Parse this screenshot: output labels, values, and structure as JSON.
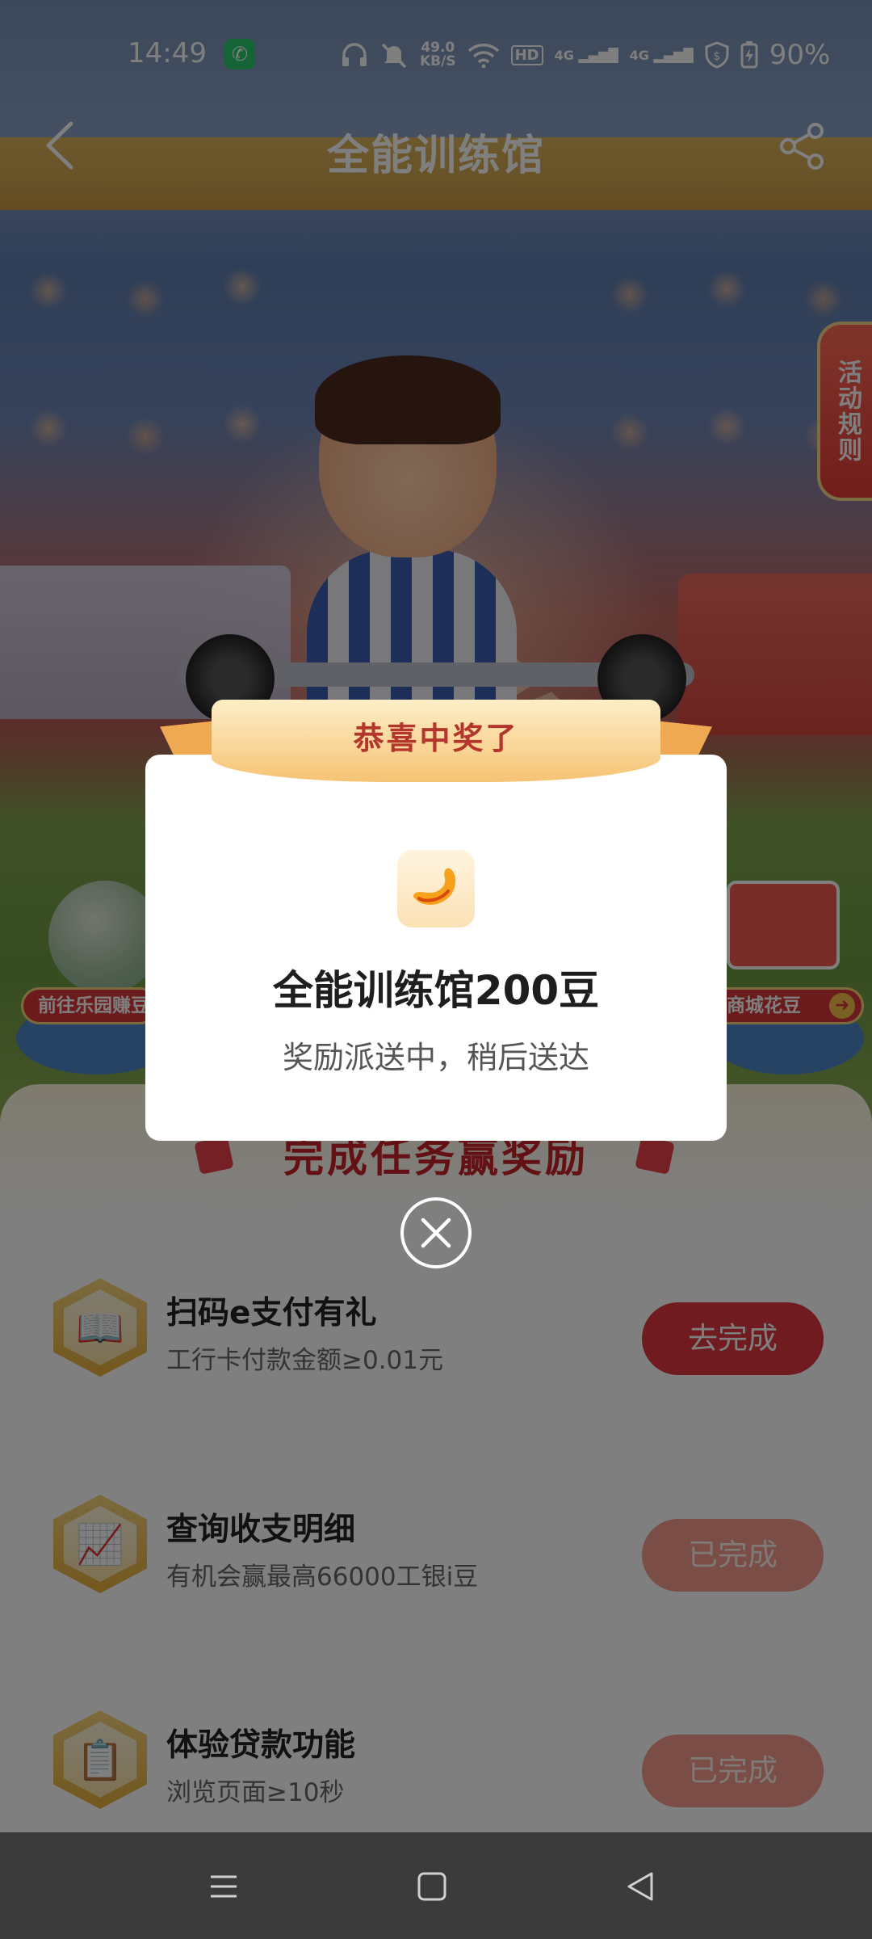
{
  "status_bar": {
    "time": "14:49",
    "net_speed_value": "49.0",
    "net_speed_unit": "KB/S",
    "hd_label": "HD",
    "signal1_label": "4G",
    "signal2_label": "4G",
    "battery": "90%"
  },
  "header": {
    "title": "全能训练馆"
  },
  "rules_tab": "活动规则",
  "entries": {
    "left": "前往乐园赚豆",
    "right": "往商城花豆"
  },
  "task_panel": {
    "title": "完成任务赢奖励",
    "tasks": [
      {
        "title": "扫码e支付有礼",
        "subtitle": "工行卡付款金额≥0.01元",
        "button": "去完成",
        "status": "pending",
        "icon": "book-icon"
      },
      {
        "title": "查询收支明细",
        "subtitle": "有机会赢最高66000工银i豆",
        "button": "已完成",
        "status": "done",
        "icon": "chart-icon"
      },
      {
        "title": "体验贷款功能",
        "subtitle": "浏览页面≥10秒",
        "button": "已完成",
        "status": "done",
        "icon": "clipboard-icon"
      }
    ]
  },
  "modal": {
    "ribbon": "恭喜中奖了",
    "prize_title": "全能训练馆200豆",
    "prize_subtitle": "奖励派送中，稍后送达",
    "prize_icon": "bean-icon"
  },
  "colors": {
    "accent_red": "#e0373f",
    "done_button": "#f59a8f",
    "ribbon_gold": "#f6c374",
    "call_green": "#28c86a"
  }
}
